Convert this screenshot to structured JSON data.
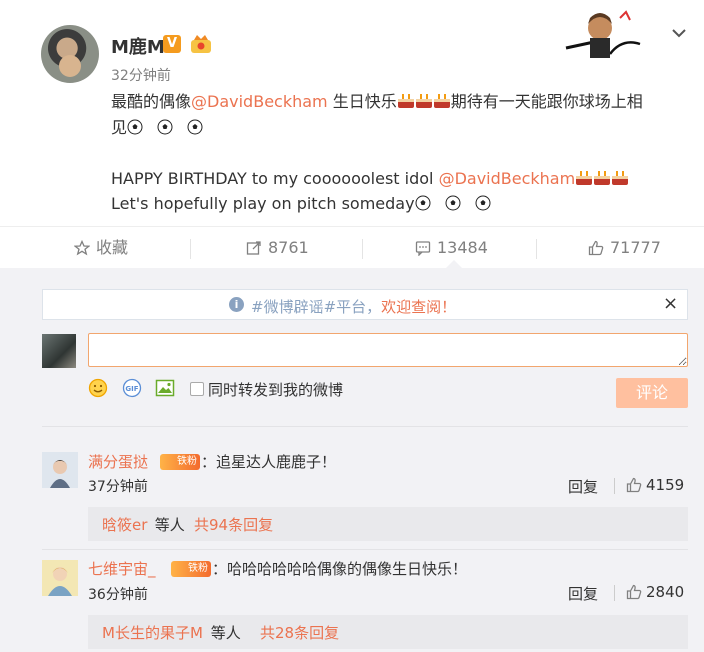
{
  "post": {
    "username": "M鹿M",
    "verified_label": "V",
    "time": "32分钟前",
    "line1_before": "最酷的偶像",
    "line1_mention": "@DavidBeckham",
    "line1_after": "  生日快乐",
    "line1_tail": "期待有一天能跟你球场上相",
    "line2": "见",
    "line3_before": "HAPPY BIRTHDAY to my coooooolest idol ",
    "line3_mention": "@DavidBeckham",
    "line4": "Let's hopefully play on pitch someday",
    "icons": [
      "cake-emoji",
      "soccer-ball-emoji",
      "crown-icon",
      "chevron-down-icon"
    ]
  },
  "actions": {
    "favorite": "收藏",
    "repost": "8761",
    "comment": "13484",
    "like": "71777"
  },
  "notice": {
    "text_before": "#微博辟谣#平台，",
    "text_highlight": "欢迎查阅！",
    "close": "×"
  },
  "composer": {
    "placeholder": "",
    "checkbox_label": "同时转发到我的微博",
    "submit": "评论",
    "tools": [
      "emoji-icon",
      "gif-icon",
      "image-icon"
    ]
  },
  "comments": [
    {
      "name": "满分蛋挞",
      "badge": "铁粉",
      "text": "：追星达人鹿鹿子！",
      "time": "37分钟前",
      "reply": "回复",
      "likes": "4159",
      "sub_name": "晗筱er",
      "sub_mid": " 等人 ",
      "sub_count": "共94条回复"
    },
    {
      "name": "七维宇宙_",
      "badge": "铁粉",
      "text": "：哈哈哈哈哈哈偶像的偶像生日快乐！",
      "time": "36分钟前",
      "reply": "回复",
      "likes": "2840",
      "sub_name": "M长生的果子M",
      "sub_mid": " 等人 ",
      "sub_count": "共28条回复"
    }
  ],
  "colors": {
    "accent": "#eb7350",
    "muted": "#808080",
    "panel": "#f2f2f5"
  }
}
